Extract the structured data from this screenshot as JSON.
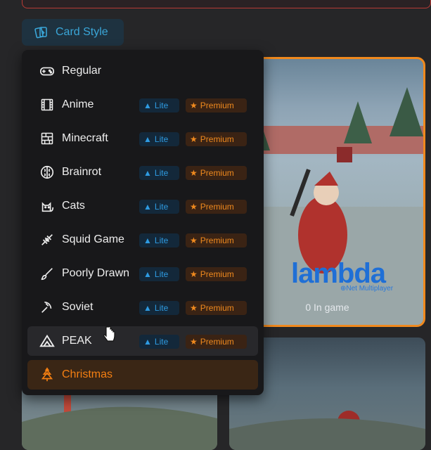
{
  "toolbar": {
    "card_style_label": "Card Style",
    "icon": "cards-icon"
  },
  "menu": {
    "items": [
      {
        "label": "Regular",
        "icon": "gamepad-icon",
        "lite": "",
        "premium": ""
      },
      {
        "label": "Anime",
        "icon": "film-icon",
        "lite": "Lite",
        "premium": "Premium"
      },
      {
        "label": "Minecraft",
        "icon": "brick-icon",
        "lite": "Lite",
        "premium": "Premium"
      },
      {
        "label": "Brainrot",
        "icon": "brain-icon",
        "lite": "Lite",
        "premium": "Premium"
      },
      {
        "label": "Cats",
        "icon": "cat-icon",
        "lite": "Lite",
        "premium": "Premium"
      },
      {
        "label": "Squid Game",
        "icon": "squid-icon",
        "lite": "Lite",
        "premium": "Premium"
      },
      {
        "label": "Poorly Drawn",
        "icon": "brush-icon",
        "lite": "Lite",
        "premium": "Premium"
      },
      {
        "label": "Soviet",
        "icon": "hammer-sickle-icon",
        "lite": "Lite",
        "premium": "Premium"
      },
      {
        "label": "PEAK",
        "icon": "mountain-icon",
        "lite": "Lite",
        "premium": "Premium"
      },
      {
        "label": "Christmas",
        "icon": "christmas-tree-icon",
        "lite": "",
        "premium": ""
      }
    ],
    "hovered": "PEAK",
    "selected": "Christmas"
  },
  "game_card": {
    "logo": "lambda",
    "subtitle": "⊕Net Multiplayer",
    "status": "0 In game"
  },
  "colors": {
    "accent_orange": "#f0891d",
    "lite_blue": "#2e9be2",
    "premium_orange": "#f08a1e"
  }
}
